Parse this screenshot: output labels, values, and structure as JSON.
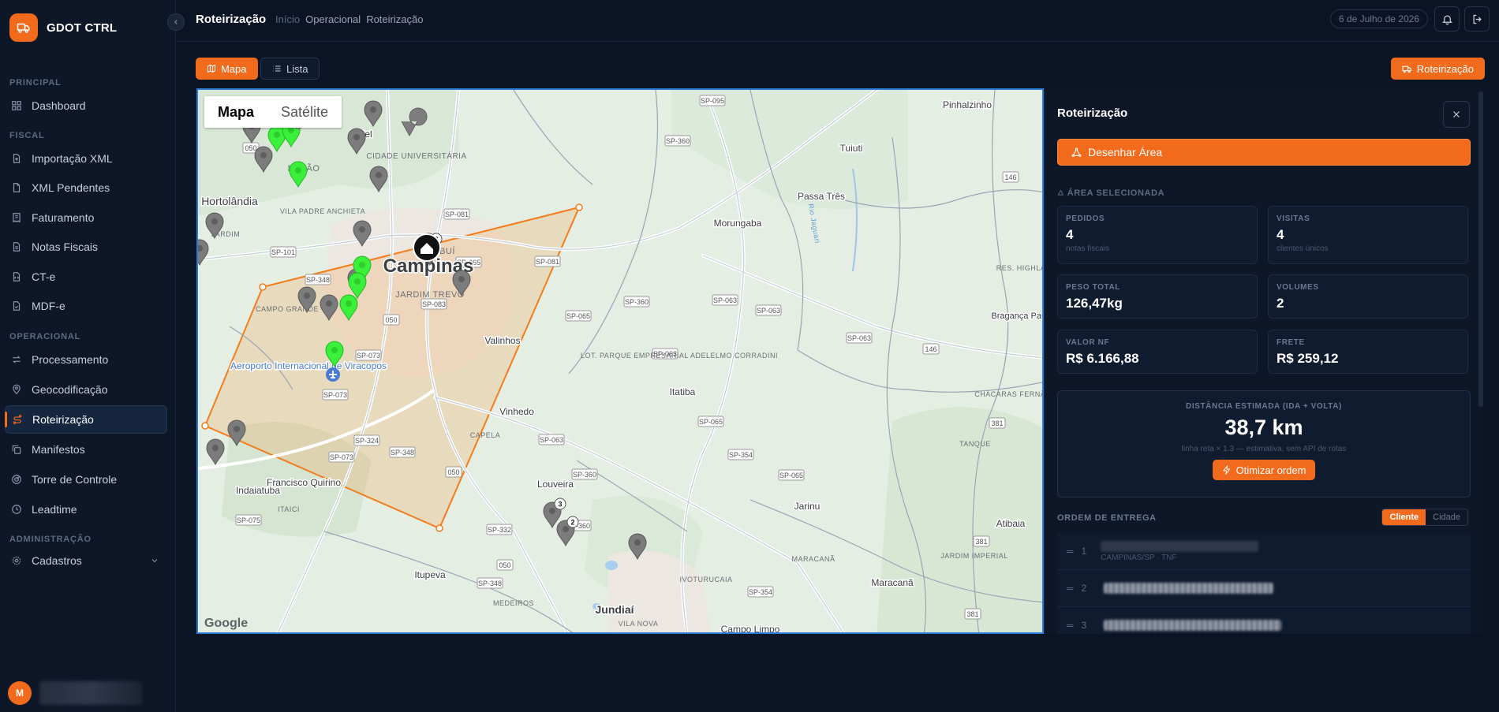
{
  "brand": {
    "name": "GDOT CTRL"
  },
  "sidebar": {
    "sections": [
      {
        "label": "PRINCIPAL"
      },
      {
        "label": "FISCAL"
      },
      {
        "label": "OPERACIONAL"
      },
      {
        "label": "ADMINISTRAÇÃO"
      }
    ],
    "items": [
      {
        "label": "Dashboard"
      },
      {
        "label": "Importação XML"
      },
      {
        "label": "XML Pendentes"
      },
      {
        "label": "Faturamento"
      },
      {
        "label": "Notas Fiscais"
      },
      {
        "label": "CT-e"
      },
      {
        "label": "MDF-e"
      },
      {
        "label": "Processamento"
      },
      {
        "label": "Geocodificação"
      },
      {
        "label": "Roteirização",
        "active": true
      },
      {
        "label": "Manifestos"
      },
      {
        "label": "Torre de Controle"
      },
      {
        "label": "Leadtime"
      },
      {
        "label": "Cadastros"
      }
    ],
    "user": {
      "initial": "M"
    }
  },
  "header": {
    "title": "Roteirização",
    "breadcrumb": [
      "Início",
      "Operacional",
      "Roteirização"
    ],
    "date": "6 de Julho de 2026"
  },
  "toolbar": {
    "map_label": "Mapa",
    "list_label": "Lista",
    "route_label": "Roteirização"
  },
  "map": {
    "toggle": {
      "map": "Mapa",
      "satellite": "Satélite"
    },
    "attribution": "Google",
    "places": {
      "campinas": "Campinas",
      "hortolandia": "Hortolândia",
      "valinhos": "Valinhos",
      "vinhedo": "Vinhedo",
      "louveira": "Louveira",
      "itupeva": "Itupeva",
      "morungaba": "Morungaba",
      "itatiba": "Itatiba",
      "jarinu": "Jarinu",
      "atibaia": "Atibaia",
      "tuiuti": "Tuiuti",
      "pinhalzinho": "Pinhalzinho",
      "passa_tres": "Passa Três",
      "indaiatuba": "Indaiatuba",
      "francisco_quirino": "Francisco Quirino",
      "betel": "Betel",
      "matao": "MATÃO",
      "braganca": "Bragança Paulista",
      "maracana": "Maracanã",
      "airport": "Aeroporto Internacional de Viracopos",
      "campo_grande": "CAMPO GRANDE",
      "jardim_trevo": "JARDIM TREVO",
      "vila_padre": "VILA PADRE ANCHIETA",
      "lot_parque": "LOT. PARQUE EMPRESARIAL ADELELMO CORRADINI",
      "capela": "CAPELA",
      "itaici": "ITAICI",
      "medeiros": "MEDEIROS",
      "ivoturucaia": "IVOTURUCAIA",
      "tanque": "TANQUE",
      "jardim_imperial": "JARDIM IMPERIAL",
      "chacaras": "CHÁCARAS FERNÃO DIAS",
      "maracana2": "MARACANÃ",
      "cidade_univ": "CIDADE UNIVERSITÁRIA",
      "jardim": "JARDIM",
      "res_highland": "RES. HIGHLAND",
      "rio_jaguari": "Rio Jaguari",
      "jundiai": "Jundiaí",
      "vila_nova": "VILA NOVA",
      "campo_limpo": "Campo Limpo",
      "bui": "BUÍ"
    },
    "roads": [
      "SP-095",
      "SP-360",
      "SP-081",
      "SP-065",
      "SP-101",
      "SP-348",
      "SP-083",
      "SP-073",
      "SP-324",
      "SP-075",
      "SP-063",
      "SP-332",
      "SP-354",
      "050",
      "146",
      "381"
    ],
    "clusters": [
      "3",
      "2",
      "3",
      "2"
    ]
  },
  "panel": {
    "title": "Roteirização",
    "draw_label": "Desenhar Área",
    "area_label": "ÁREA SELECIONADA",
    "stats": [
      {
        "key": "PEDIDOS",
        "value": "4",
        "sub": "notas fiscais"
      },
      {
        "key": "VISITAS",
        "value": "4",
        "sub": "clientes únicos"
      },
      {
        "key": "PESO TOTAL",
        "value": "126,47kg"
      },
      {
        "key": "VOLUMES",
        "value": "2"
      },
      {
        "key": "VALOR NF",
        "value": "R$ 6.166,88"
      },
      {
        "key": "FRETE",
        "value": "R$ 259,12"
      }
    ],
    "distance": {
      "label": "DISTÂNCIA ESTIMADA (IDA + VOLTA)",
      "value": "38,7 km",
      "note": "linha reta × 1.3 — estimativa, sem API de rotas",
      "optimize_label": "Otimizar ordem"
    },
    "order": {
      "label": "ORDEM DE ENTREGA",
      "seg_client": "Cliente",
      "seg_city": "Cidade",
      "rows": [
        {
          "index": "1",
          "city": "CAMPINAS/SP · TNF"
        },
        {
          "index": "2"
        },
        {
          "index": "3"
        }
      ]
    }
  },
  "colors": {
    "accent": "#f26b1d",
    "bg": "#0b1424",
    "sidebar": "#0d1728",
    "map_border": "#2b7bd6"
  }
}
